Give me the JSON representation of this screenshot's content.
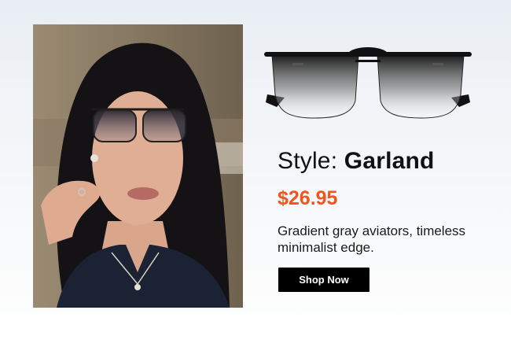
{
  "product": {
    "style_prefix": "Style:",
    "style_name": "Garland",
    "price": "$26.95",
    "description": "Gradient gray aviators, timeless minimalist edge.",
    "cta_label": "Shop Now"
  },
  "colors": {
    "price": "#f2531f",
    "button_bg": "#000000",
    "button_text": "#ffffff"
  }
}
